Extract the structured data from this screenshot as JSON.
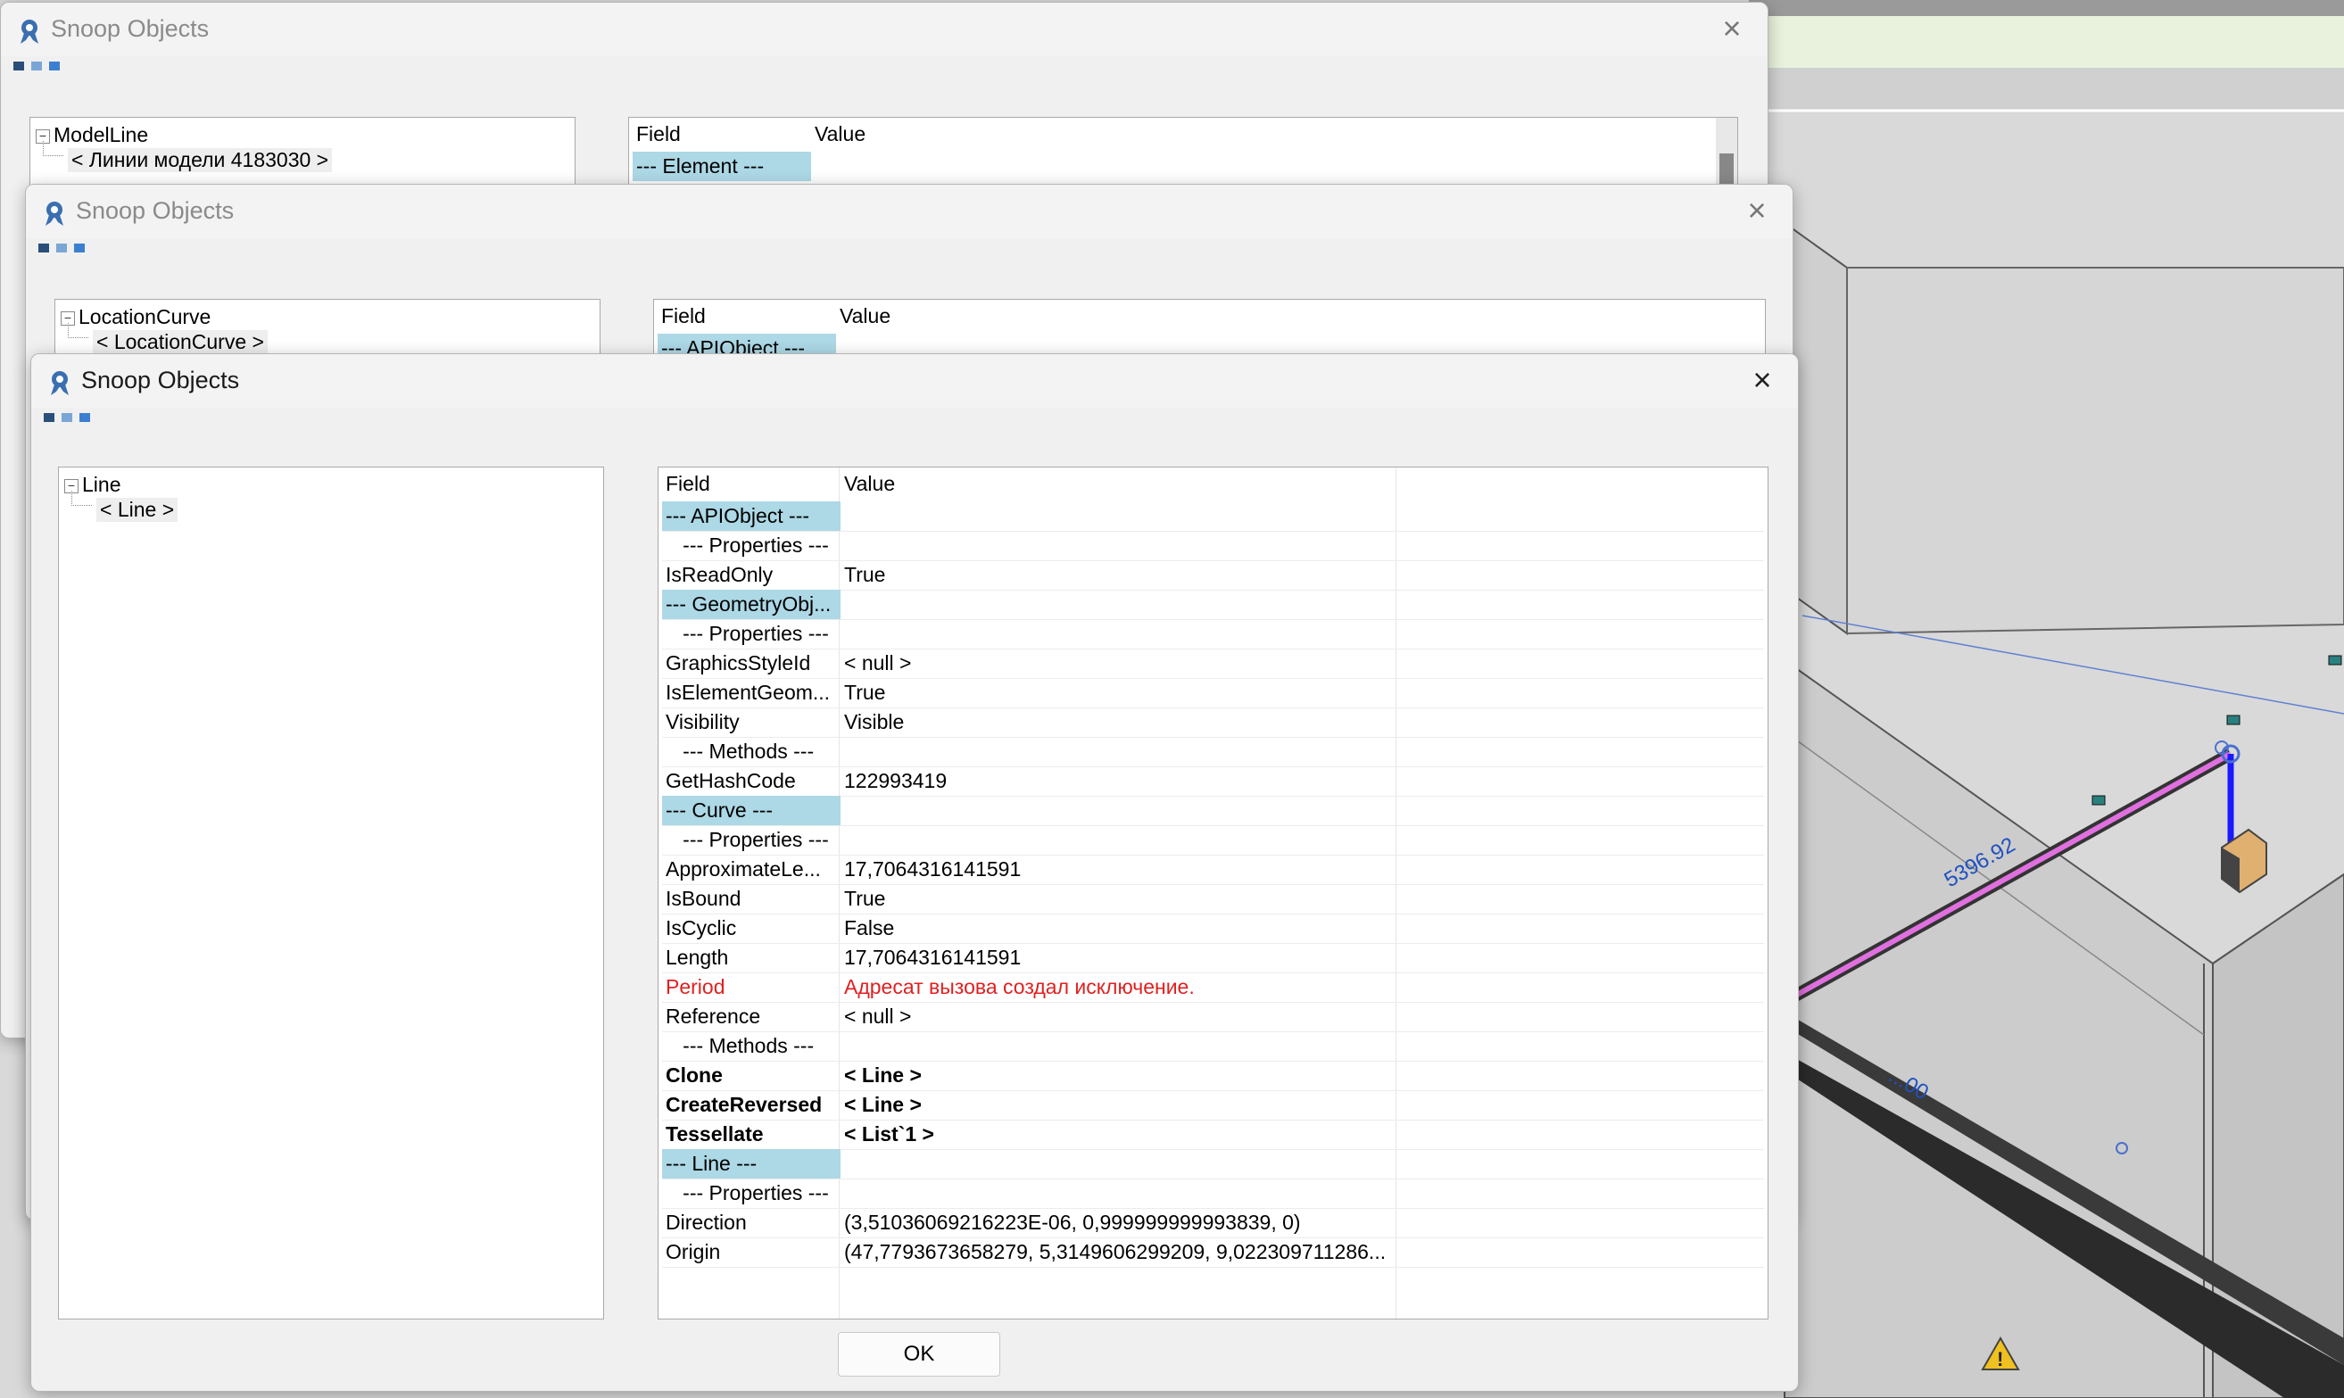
{
  "window_title": "Snoop Objects",
  "back_window": {
    "tree_root": "ModelLine",
    "tree_child": "< Линии модели  4183030 >",
    "grid_header": {
      "field": "Field",
      "value": "Value"
    },
    "first_row": "--- Element ---"
  },
  "middle_window": {
    "tree_root": "LocationCurve",
    "tree_child": "< LocationCurve >",
    "grid_header": {
      "field": "Field",
      "value": "Value"
    },
    "first_row": "--- APIObject ---"
  },
  "front_window": {
    "tree_root": "Line",
    "tree_child": "< Line >",
    "grid_header": {
      "field": "Field",
      "value": "Value"
    },
    "rows": [
      {
        "field": "--- APIObject ---",
        "value": "",
        "kind": "sep"
      },
      {
        "field": "   --- Properties ---",
        "value": "",
        "kind": "sub"
      },
      {
        "field": "IsReadOnly",
        "value": "True",
        "kind": "normal"
      },
      {
        "field": "--- GeometryObj...",
        "value": "",
        "kind": "sep"
      },
      {
        "field": "   --- Properties ---",
        "value": "",
        "kind": "sub"
      },
      {
        "field": "GraphicsStyleId",
        "value": "< null >",
        "kind": "normal"
      },
      {
        "field": "IsElementGeom...",
        "value": "True",
        "kind": "normal"
      },
      {
        "field": "Visibility",
        "value": "Visible",
        "kind": "normal"
      },
      {
        "field": "   --- Methods ---",
        "value": "",
        "kind": "sub"
      },
      {
        "field": "GetHashCode",
        "value": "122993419",
        "kind": "normal"
      },
      {
        "field": "--- Curve ---",
        "value": "",
        "kind": "sep"
      },
      {
        "field": "   --- Properties ---",
        "value": "",
        "kind": "sub"
      },
      {
        "field": "ApproximateLe...",
        "value": "17,7064316141591",
        "kind": "normal"
      },
      {
        "field": "IsBound",
        "value": "True",
        "kind": "normal"
      },
      {
        "field": "IsCyclic",
        "value": "False",
        "kind": "normal"
      },
      {
        "field": "Length",
        "value": "17,7064316141591",
        "kind": "normal"
      },
      {
        "field": "Period",
        "value": "Адресат вызова создал исключение.",
        "kind": "err"
      },
      {
        "field": "Reference",
        "value": "< null >",
        "kind": "normal"
      },
      {
        "field": "   --- Methods ---",
        "value": "",
        "kind": "sub"
      },
      {
        "field": "Clone",
        "value": "< Line >",
        "kind": "bold"
      },
      {
        "field": "CreateReversed",
        "value": "< Line >",
        "kind": "bold"
      },
      {
        "field": "Tessellate",
        "value": "< List`1 >",
        "kind": "bold"
      },
      {
        "field": "--- Line ---",
        "value": "",
        "kind": "sep"
      },
      {
        "field": "   --- Properties ---",
        "value": "",
        "kind": "sub"
      },
      {
        "field": "Direction",
        "value": "(3,51036069216223E-06, 0,999999999993839, 0)",
        "kind": "normal"
      },
      {
        "field": "Origin",
        "value": "(47,7793673658279, 5,3149606299209, 9,022309711286...",
        "kind": "normal"
      }
    ],
    "ok_label": "OK"
  },
  "scene": {
    "dimension_label_1": "5396.92",
    "dimension_label_2": "...00",
    "accent_pipe": "#e070e0",
    "accent_vertical": "#1a1aff",
    "dimension_color": "#2050c0"
  },
  "colors": {
    "separator_row": "#add8e6",
    "error_text": "#e02020"
  }
}
